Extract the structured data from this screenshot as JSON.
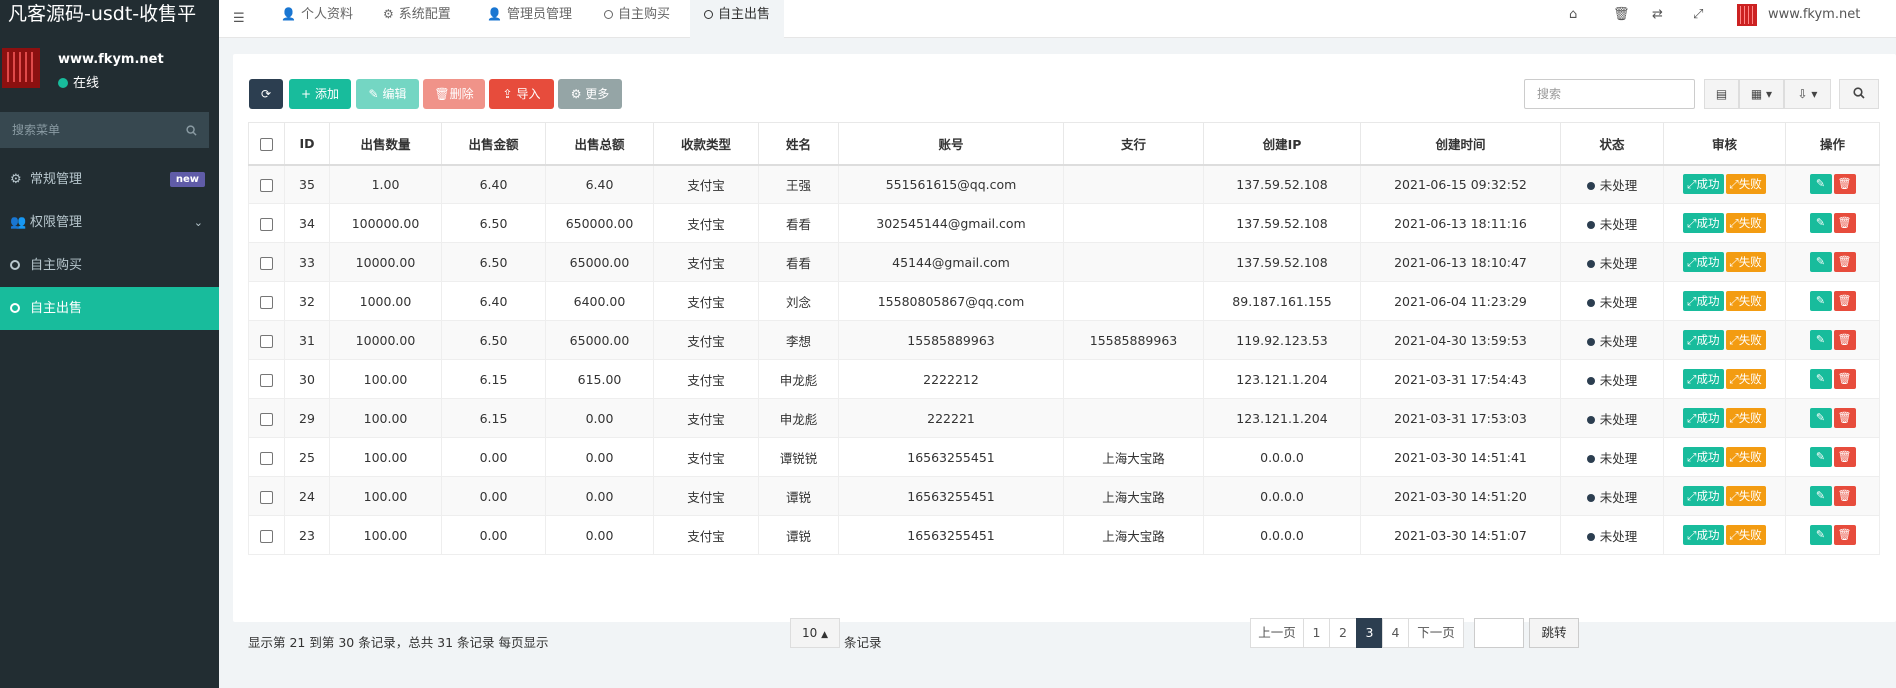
{
  "app_title": "凡客源码-usdt-收售平",
  "user": {
    "site": "www.fkym.net",
    "status": "在线"
  },
  "sidebar": {
    "search_placeholder": "搜索菜单",
    "items": [
      {
        "label": "常规管理",
        "badge": "new"
      },
      {
        "label": "权限管理"
      },
      {
        "label": "自主购买"
      },
      {
        "label": "自主出售",
        "active": true
      }
    ]
  },
  "topbar": {
    "tabs": [
      {
        "label": "个人资料",
        "icon": "user-icon"
      },
      {
        "label": "系统配置",
        "icon": "gear-icon"
      },
      {
        "label": "管理员管理",
        "icon": "user-icon"
      },
      {
        "label": "自主购买",
        "icon": "circle-icon"
      },
      {
        "label": "自主出售",
        "icon": "circle-icon",
        "active": true
      }
    ],
    "site": "www.fkym.net",
    "icons": [
      "home-icon",
      "trash-icon",
      "translate-icon",
      "fullscreen-icon"
    ]
  },
  "toolbar": {
    "add": "添加",
    "edit": "编辑",
    "delete": "删除",
    "import": "导入",
    "more": "更多",
    "search_placeholder": "搜索"
  },
  "table": {
    "headers": [
      "ID",
      "出售数量",
      "出售金额",
      "出售总额",
      "收款类型",
      "姓名",
      "账号",
      "支行",
      "创建IP",
      "创建时间",
      "状态",
      "审核",
      "操作"
    ],
    "rows": [
      [
        "35",
        "1.00",
        "6.40",
        "6.40",
        "支付宝",
        "王强",
        "551561615@qq.com",
        "",
        "137.59.52.108",
        "2021-06-15 09:32:52",
        "未处理"
      ],
      [
        "34",
        "100000.00",
        "6.50",
        "650000.00",
        "支付宝",
        "看看",
        "302545144@gmail.com",
        "",
        "137.59.52.108",
        "2021-06-13 18:11:16",
        "未处理"
      ],
      [
        "33",
        "10000.00",
        "6.50",
        "65000.00",
        "支付宝",
        "看看",
        "45144@gmail.com",
        "",
        "137.59.52.108",
        "2021-06-13 18:10:47",
        "未处理"
      ],
      [
        "32",
        "1000.00",
        "6.40",
        "6400.00",
        "支付宝",
        "刘念",
        "15580805867@qq.com",
        "",
        "89.187.161.155",
        "2021-06-04 11:23:29",
        "未处理"
      ],
      [
        "31",
        "10000.00",
        "6.50",
        "65000.00",
        "支付宝",
        "李想",
        "15585889963",
        "15585889963",
        "119.92.123.53",
        "2021-04-30 13:59:53",
        "未处理"
      ],
      [
        "30",
        "100.00",
        "6.15",
        "615.00",
        "支付宝",
        "申龙彪",
        "2222212",
        "",
        "123.121.1.204",
        "2021-03-31 17:54:43",
        "未处理"
      ],
      [
        "29",
        "100.00",
        "6.15",
        "0.00",
        "支付宝",
        "申龙彪",
        "222221",
        "",
        "123.121.1.204",
        "2021-03-31 17:53:03",
        "未处理"
      ],
      [
        "25",
        "100.00",
        "0.00",
        "0.00",
        "支付宝",
        "谭锐锐",
        "16563255451",
        "上海大宝路",
        "0.0.0.0",
        "2021-03-30 14:51:41",
        "未处理"
      ],
      [
        "24",
        "100.00",
        "0.00",
        "0.00",
        "支付宝",
        "谭锐",
        "16563255451",
        "上海大宝路",
        "0.0.0.0",
        "2021-03-30 14:51:20",
        "未处理"
      ],
      [
        "23",
        "100.00",
        "0.00",
        "0.00",
        "支付宝",
        "谭锐",
        "16563255451",
        "上海大宝路",
        "0.0.0.0",
        "2021-03-30 14:51:07",
        "未处理"
      ]
    ],
    "audit": {
      "success": "成功",
      "fail": "失败"
    }
  },
  "pagination": {
    "info": "显示第 21 到第 30 条记录，总共 31 条记录 每页显示",
    "page_size": "10",
    "suffix": "条记录",
    "prev": "上一页",
    "pages": [
      "1",
      "2",
      "3",
      "4"
    ],
    "current": "3",
    "next": "下一页",
    "jump": "跳转"
  },
  "colors": {
    "primary": "#18bc9c",
    "danger": "#e74c3c",
    "warning": "#f39c12",
    "dark": "#2c3e50",
    "sidebar": "#222d32"
  }
}
